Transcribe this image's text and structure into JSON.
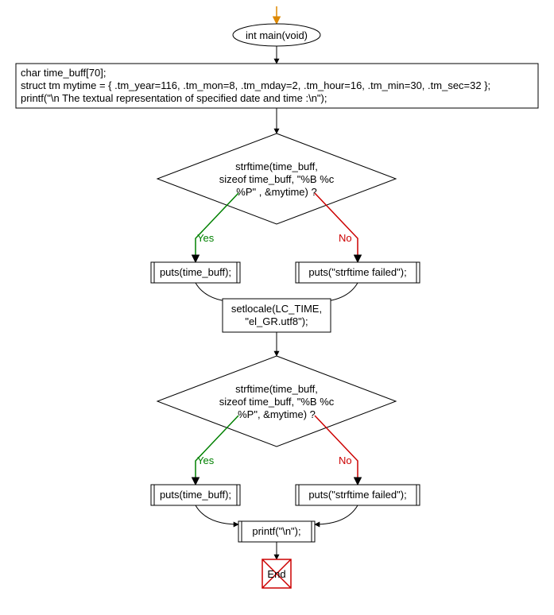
{
  "flow": {
    "start": {
      "label": "int main(void)"
    },
    "init_block": {
      "line1": "char time_buff[70];",
      "line2": "struct tm mytime = { .tm_year=116, .tm_mon=8, .tm_mday=2, .tm_hour=16, .tm_min=30, .tm_sec=32 };",
      "line3": "printf(\"\\n The textual representation of specified date and time :\\n\");"
    },
    "decision1": {
      "line1": "strftime(time_buff,",
      "line2": "sizeof time_buff, \"%B %c",
      "line3": "%P\" , &mytime)  ?"
    },
    "branch1_yes_label": "Yes",
    "branch1_no_label": "No",
    "branch1_yes_action": "puts(time_buff);",
    "branch1_no_action": "puts(\"strftime failed\");",
    "setlocale": {
      "line1": "setlocale(LC_TIME,",
      "line2": "\"el_GR.utf8\");"
    },
    "decision2": {
      "line1": "strftime(time_buff,",
      "line2": "sizeof time_buff, \"%B %c",
      "line3": "%P\", &mytime)  ?"
    },
    "branch2_yes_label": "Yes",
    "branch2_no_label": "No",
    "branch2_yes_action": "puts(time_buff);",
    "branch2_no_action": "puts(\"strftime failed\");",
    "final_printf": "printf(\"\\n\");",
    "end": "End"
  }
}
